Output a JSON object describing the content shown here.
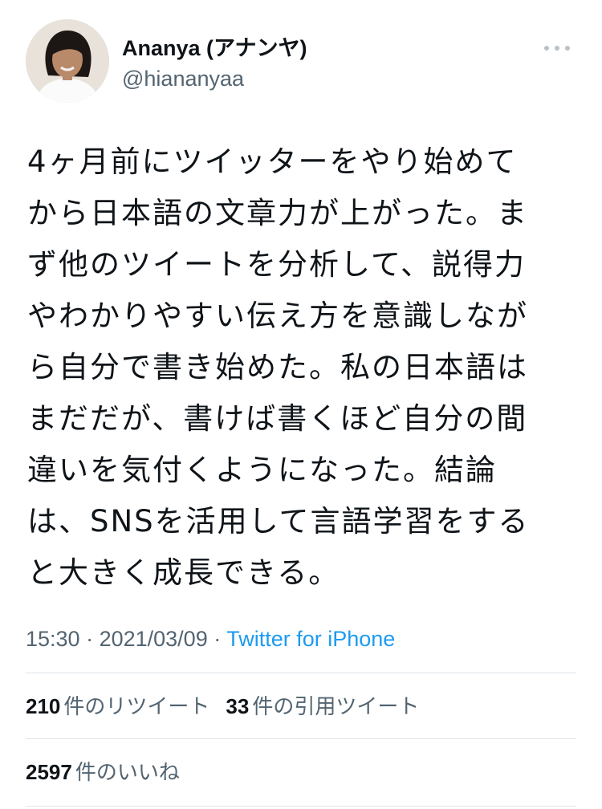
{
  "user": {
    "display_name": "Ananya (アナンヤ)",
    "handle": "@hiananyaa"
  },
  "tweet": {
    "text_lines": [
      "4ヶ月前にツイッターをやり始めて",
      "から日本語の文章力が上がった。ま",
      "ず他のツイートを分析して、説得力",
      "やわかりやすい伝え方を意識しなが",
      "ら自分で書き始めた。私の日本語は",
      "まだだが、書けば書くほど自分の間",
      "違いを気付くようになった。結論",
      "は、SNSを活用して言語学習をする",
      "と大きく成長できる。"
    ],
    "time": "15:30",
    "separator": " · ",
    "date": "2021/03/09",
    "source": "Twitter for iPhone"
  },
  "stats": {
    "retweets": {
      "count": "210",
      "label": "件のリツイート"
    },
    "quotes": {
      "count": "33",
      "label": "件の引用ツイート"
    },
    "likes": {
      "count": "2597",
      "label": "件のいいね"
    }
  },
  "colors": {
    "text": "#0f1419",
    "secondary": "#536471",
    "link": "#1d9bf0",
    "divider": "#dfe4e8"
  },
  "icons": {
    "more": "more-options-icon",
    "avatar": "profile-avatar"
  }
}
